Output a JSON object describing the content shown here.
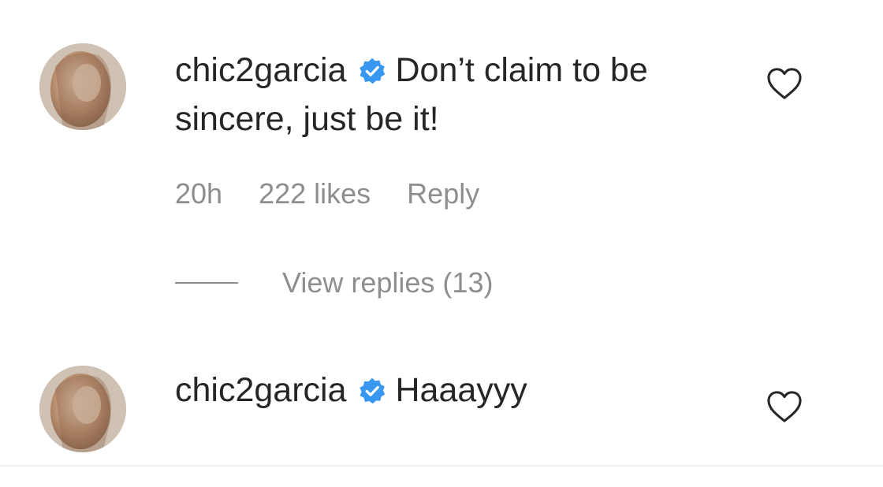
{
  "comments": [
    {
      "username": "chic2garcia",
      "verified_icon": "verified-badge-icon",
      "text": "Don’t claim to be sincere, just be it!",
      "time": "20h",
      "likes": "222 likes",
      "reply_label": "Reply",
      "view_replies": "View replies (13)",
      "like_icon": "heart-outline-icon"
    },
    {
      "username": "chic2garcia",
      "verified_icon": "verified-badge-icon",
      "text": "Haaayyy",
      "like_icon": "heart-outline-icon"
    }
  ],
  "colors": {
    "text": "#262626",
    "secondary": "#8e8e8e",
    "verified": "#3897f0"
  }
}
